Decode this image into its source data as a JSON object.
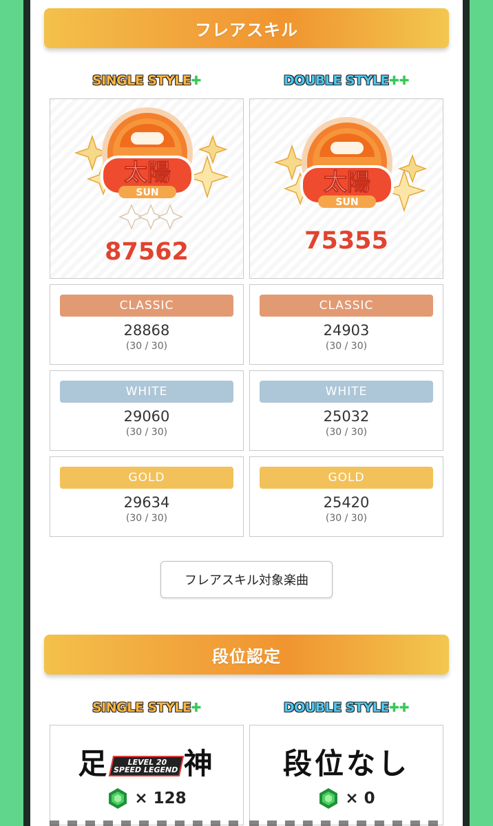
{
  "flare": {
    "title": "フレアスキル",
    "single": {
      "label": "SINGLE STYLE",
      "rank": "太陽",
      "rank_sub": "SUN",
      "score": "87562",
      "stats": [
        {
          "name": "CLASSIC",
          "value": "28868",
          "count": "(30 / 30)",
          "color": "#e29a73"
        },
        {
          "name": "WHITE",
          "value": "29060",
          "count": "(30 / 30)",
          "color": "#adc6d8"
        },
        {
          "name": "GOLD",
          "value": "29634",
          "count": "(30 / 30)",
          "color": "#f2c15a"
        }
      ]
    },
    "double": {
      "label": "DOUBLE STYLE",
      "rank": "太陽",
      "rank_sub": "SUN",
      "score": "75355",
      "stats": [
        {
          "name": "CLASSIC",
          "value": "24903",
          "count": "(30 / 30)",
          "color": "#e29a73"
        },
        {
          "name": "WHITE",
          "value": "25032",
          "count": "(30 / 30)",
          "color": "#adc6d8"
        },
        {
          "name": "GOLD",
          "value": "25420",
          "count": "(30 / 30)",
          "color": "#f2c15a"
        }
      ]
    },
    "target_button": "フレアスキル対象楽曲"
  },
  "dan": {
    "title": "段位認定",
    "single": {
      "label": "SINGLE STYLE",
      "rank_left": "足",
      "rank_right": "神",
      "rank_badge": "LEVEL 20",
      "rank_badge2": "SPEED LEGEND",
      "gems": "× 128"
    },
    "double": {
      "label": "DOUBLE STYLE",
      "rank": "段位なし",
      "gems": "× 0"
    }
  },
  "colors": {
    "background": "#5fd68c",
    "score": "#e0432f",
    "bar_orange": "#f0952f",
    "bar_yellow": "#f3c14a",
    "gem": "#2bb04a"
  }
}
